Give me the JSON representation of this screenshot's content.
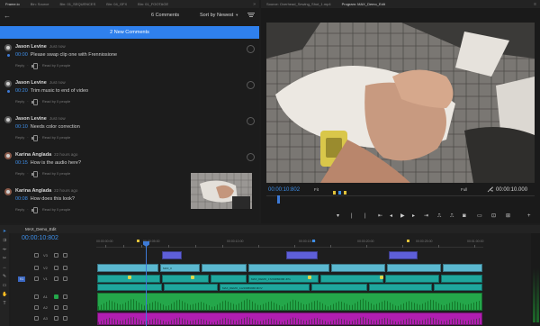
{
  "left_tabs": [
    "Frame.io",
    "Bin: Source",
    "Bin: 01_SEQUENCES",
    "Bin: 04_GFX",
    "Bin: 01_FOOTAGE"
  ],
  "right_tabs": [
    "Source: Overhead_Sewing_Shot_1.mp4",
    "Program: MAX_Demo_Edit"
  ],
  "comments_header": {
    "count": "6 Comments",
    "sort_label": "Sort by Newest",
    "new_comments_banner": "2 New Comments"
  },
  "comments": [
    {
      "author": "Jason Levine",
      "time": "Just now",
      "timecode": "00:00",
      "text": "Please swap clip one with Frenniosione",
      "reply": "Reply",
      "seen": "Read by 0 people",
      "unread": true
    },
    {
      "author": "Jason Levine",
      "time": "Just now",
      "timecode": "00:20",
      "text": "Trim music to end of video",
      "reply": "Reply",
      "seen": "Read by 0 people",
      "unread": true
    },
    {
      "author": "Jason Levine",
      "time": "Just now",
      "timecode": "00:10",
      "text": "Needs color correction",
      "reply": "Reply",
      "seen": "Read by 0 people",
      "unread": false
    },
    {
      "author": "Karina Anglada",
      "time": "22 hours ago",
      "timecode": "00:15",
      "text": "How is the audio here?",
      "reply": "Reply",
      "seen": "Read by 0 people",
      "unread": false
    },
    {
      "author": "Karina Anglada",
      "time": "22 hours ago",
      "timecode": "00:08",
      "text": "How does this look?",
      "reply": "Reply",
      "seen": "Read by 0 people",
      "unread": false
    }
  ],
  "monitor": {
    "current_timecode": "00:00:10:802",
    "fit": "Fit",
    "quality": "Full",
    "duration": "00:00:10.000"
  },
  "timeline": {
    "sequence_tab": "MAX_Demo_Edit",
    "timecode": "00:00:10:802",
    "ruler_labels": [
      "00:00:00:00",
      "00:00:05:00",
      "00:00:10:00",
      "00:00:15:00",
      "00:00:20:00",
      "00:00:25:00",
      "00:01:00:00"
    ],
    "tracks": [
      "V3",
      "V2",
      "V1",
      "A1",
      "A2",
      "A3"
    ],
    "v1_target": "V1",
    "clip_labels": {
      "graphic": "MAX_0",
      "v1": "MAX_DEMO_17219882368.JPG",
      "v1b": "MAX_DEMO_11219883968.MOV"
    }
  },
  "colors": {
    "accent": "#2f80ed",
    "timecode": "#3d8ee8",
    "clip_teal": "#1fa79d",
    "clip_light_blue": "#5bb8d0",
    "clip_purple": "#5e5fd8",
    "audio_green": "#24a74a",
    "audio_magenta": "#b01eb0"
  }
}
